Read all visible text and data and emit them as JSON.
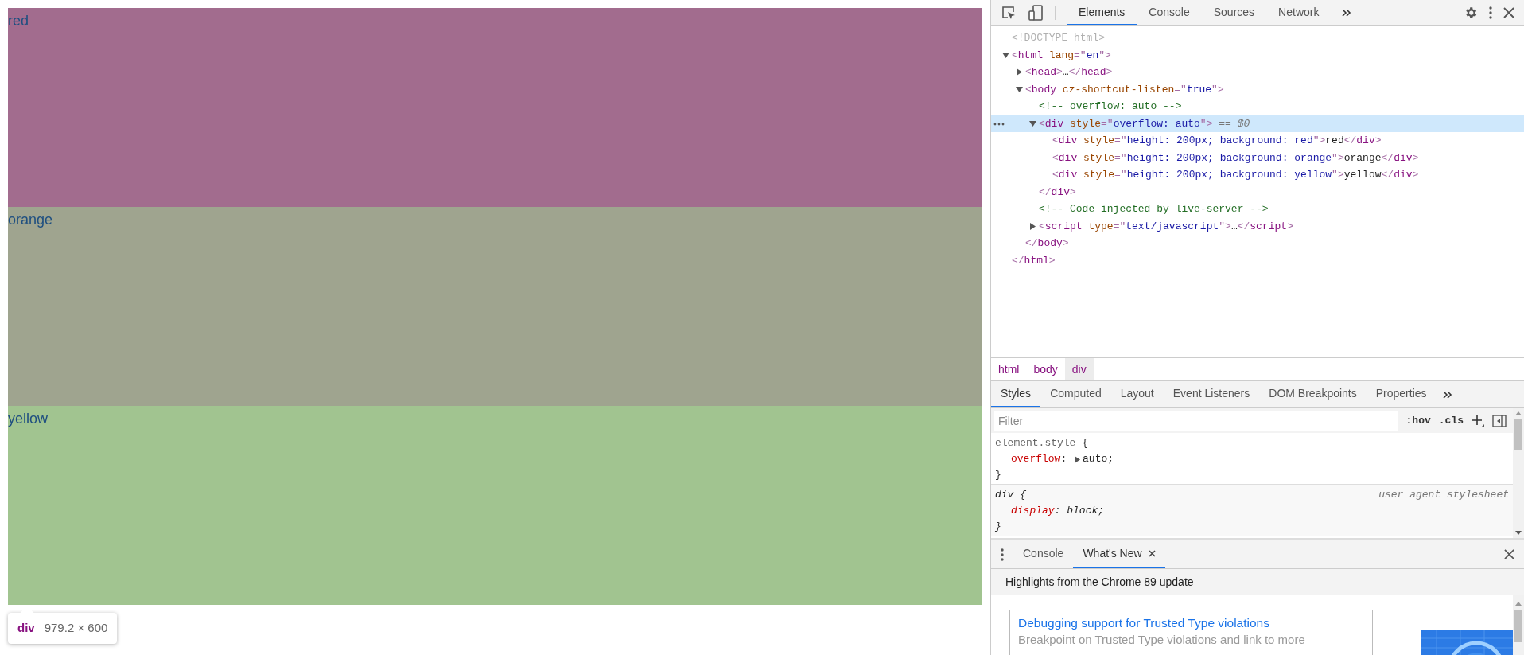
{
  "page": {
    "blocks": [
      {
        "label": "red",
        "color": "#a26c8e"
      },
      {
        "label": "orange",
        "color": "#9fa48f"
      },
      {
        "label": "yellow",
        "color": "#a1c490"
      }
    ],
    "tooltip": {
      "tag": "div",
      "size": "979.2 × 600"
    }
  },
  "devtools": {
    "tabs": [
      {
        "label": "Elements",
        "selected": true
      },
      {
        "label": "Console",
        "selected": false
      },
      {
        "label": "Sources",
        "selected": false
      },
      {
        "label": "Network",
        "selected": false
      }
    ],
    "dom": [
      {
        "tokens": [
          {
            "kind": "doctype",
            "s": "<!DOCTYPE html>"
          }
        ]
      },
      {
        "expanded": true,
        "selected": false,
        "tokens": [
          {
            "kind": "punct",
            "s": "<"
          },
          {
            "kind": "tag",
            "s": "html"
          },
          {
            "kind": "attr",
            "s": " lang"
          },
          {
            "kind": "punct",
            "s": "=\""
          },
          {
            "kind": "value",
            "s": "en"
          },
          {
            "kind": "punct",
            "s": "\">"
          }
        ],
        "close": [
          {
            "kind": "punct",
            "s": "</"
          },
          {
            "kind": "tag",
            "s": "html"
          },
          {
            "kind": "punct",
            "s": ">"
          }
        ],
        "children": [
          {
            "expanded": false,
            "selected": false,
            "tokens": [
              {
                "kind": "punct",
                "s": "<"
              },
              {
                "kind": "tag",
                "s": "head"
              },
              {
                "kind": "punct",
                "s": ">"
              },
              {
                "kind": "text",
                "s": "…"
              },
              {
                "kind": "punct",
                "s": "</"
              },
              {
                "kind": "tag",
                "s": "head"
              },
              {
                "kind": "punct",
                "s": ">"
              }
            ]
          },
          {
            "expanded": true,
            "selected": false,
            "tokens": [
              {
                "kind": "punct",
                "s": "<"
              },
              {
                "kind": "tag",
                "s": "body"
              },
              {
                "kind": "attr",
                "s": " cz-shortcut-listen"
              },
              {
                "kind": "punct",
                "s": "=\""
              },
              {
                "kind": "value",
                "s": "true"
              },
              {
                "kind": "punct",
                "s": "\">"
              }
            ],
            "close": [
              {
                "kind": "punct",
                "s": "</"
              },
              {
                "kind": "tag",
                "s": "body"
              },
              {
                "kind": "punct",
                "s": ">"
              }
            ],
            "children": [
              {
                "tokens": [
                  {
                    "kind": "comment",
                    "s": "<!-- overflow: auto -->"
                  }
                ]
              },
              {
                "expanded": true,
                "selected": true,
                "tokens": [
                  {
                    "kind": "punct",
                    "s": "<"
                  },
                  {
                    "kind": "tag",
                    "s": "div"
                  },
                  {
                    "kind": "attr",
                    "s": " style"
                  },
                  {
                    "kind": "punct",
                    "s": "=\""
                  },
                  {
                    "kind": "value",
                    "s": "overflow: auto"
                  },
                  {
                    "kind": "punct",
                    "s": "\">"
                  },
                  {
                    "kind": "marker",
                    "s": " == $0"
                  }
                ],
                "close": [
                  {
                    "kind": "punct",
                    "s": "</"
                  },
                  {
                    "kind": "tag",
                    "s": "div"
                  },
                  {
                    "kind": "punct",
                    "s": ">"
                  }
                ],
                "children": [
                  {
                    "tokens": [
                      {
                        "kind": "punct",
                        "s": "<"
                      },
                      {
                        "kind": "tag",
                        "s": "div"
                      },
                      {
                        "kind": "attr",
                        "s": " style"
                      },
                      {
                        "kind": "punct",
                        "s": "=\""
                      },
                      {
                        "kind": "value",
                        "s": "height: 200px; background: red"
                      },
                      {
                        "kind": "punct",
                        "s": "\">"
                      },
                      {
                        "kind": "text",
                        "s": "red"
                      },
                      {
                        "kind": "punct",
                        "s": "</"
                      },
                      {
                        "kind": "tag",
                        "s": "div"
                      },
                      {
                        "kind": "punct",
                        "s": ">"
                      }
                    ]
                  },
                  {
                    "tokens": [
                      {
                        "kind": "punct",
                        "s": "<"
                      },
                      {
                        "kind": "tag",
                        "s": "div"
                      },
                      {
                        "kind": "attr",
                        "s": " style"
                      },
                      {
                        "kind": "punct",
                        "s": "=\""
                      },
                      {
                        "kind": "value",
                        "s": "height: 200px; background: orange"
                      },
                      {
                        "kind": "punct",
                        "s": "\">"
                      },
                      {
                        "kind": "text",
                        "s": "orange"
                      },
                      {
                        "kind": "punct",
                        "s": "</"
                      },
                      {
                        "kind": "tag",
                        "s": "div"
                      },
                      {
                        "kind": "punct",
                        "s": ">"
                      }
                    ]
                  },
                  {
                    "tokens": [
                      {
                        "kind": "punct",
                        "s": "<"
                      },
                      {
                        "kind": "tag",
                        "s": "div"
                      },
                      {
                        "kind": "attr",
                        "s": " style"
                      },
                      {
                        "kind": "punct",
                        "s": "=\""
                      },
                      {
                        "kind": "value",
                        "s": "height: 200px; background: yellow"
                      },
                      {
                        "kind": "punct",
                        "s": "\">"
                      },
                      {
                        "kind": "text",
                        "s": "yellow"
                      },
                      {
                        "kind": "punct",
                        "s": "</"
                      },
                      {
                        "kind": "tag",
                        "s": "div"
                      },
                      {
                        "kind": "punct",
                        "s": ">"
                      }
                    ]
                  }
                ]
              },
              {
                "tokens": [
                  {
                    "kind": "comment",
                    "s": "<!-- Code injected by live-server -->"
                  }
                ]
              },
              {
                "expanded": false,
                "selected": false,
                "tokens": [
                  {
                    "kind": "punct",
                    "s": "<"
                  },
                  {
                    "kind": "tag",
                    "s": "script"
                  },
                  {
                    "kind": "attr",
                    "s": " type"
                  },
                  {
                    "kind": "punct",
                    "s": "=\""
                  },
                  {
                    "kind": "value",
                    "s": "text/javascript"
                  },
                  {
                    "kind": "punct",
                    "s": "\">"
                  },
                  {
                    "kind": "text",
                    "s": "…"
                  },
                  {
                    "kind": "punct",
                    "s": "</"
                  },
                  {
                    "kind": "tag",
                    "s": "script"
                  },
                  {
                    "kind": "punct",
                    "s": ">"
                  }
                ]
              }
            ]
          }
        ]
      }
    ],
    "breadcrumbs": [
      {
        "label": "html",
        "selected": false
      },
      {
        "label": "body",
        "selected": false
      },
      {
        "label": "div",
        "selected": true
      }
    ],
    "sidebar_tabs": [
      {
        "label": "Styles",
        "selected": true
      },
      {
        "label": "Computed",
        "selected": false
      },
      {
        "label": "Layout",
        "selected": false
      },
      {
        "label": "Event Listeners",
        "selected": false
      },
      {
        "label": "DOM Breakpoints",
        "selected": false
      },
      {
        "label": "Properties",
        "selected": false
      }
    ],
    "filter": {
      "placeholder": "Filter",
      "hov": ":hov",
      "cls": ".cls"
    },
    "rules": [
      {
        "kind": "inline",
        "selector": "element.style",
        "open": "{",
        "close": "}",
        "props": [
          {
            "name": "overflow",
            "colon": ":",
            "value": "auto;",
            "expandable": true
          }
        ]
      },
      {
        "kind": "user_agent",
        "selector": "div",
        "open": "{",
        "close": "}",
        "origin": "user agent stylesheet",
        "props": [
          {
            "name": "display",
            "colon": ":",
            "value": "block;",
            "expandable": false
          }
        ]
      }
    ],
    "drawer": {
      "tabs": [
        {
          "label": "Console",
          "selected": false,
          "closable": false
        },
        {
          "label": "What's New",
          "selected": true,
          "closable": true
        }
      ],
      "heading": "Highlights from the Chrome 89 update",
      "card": {
        "title": "Debugging support for Trusted Type violations",
        "description": "Breakpoint on Trusted Type violations and link to more"
      }
    }
  }
}
